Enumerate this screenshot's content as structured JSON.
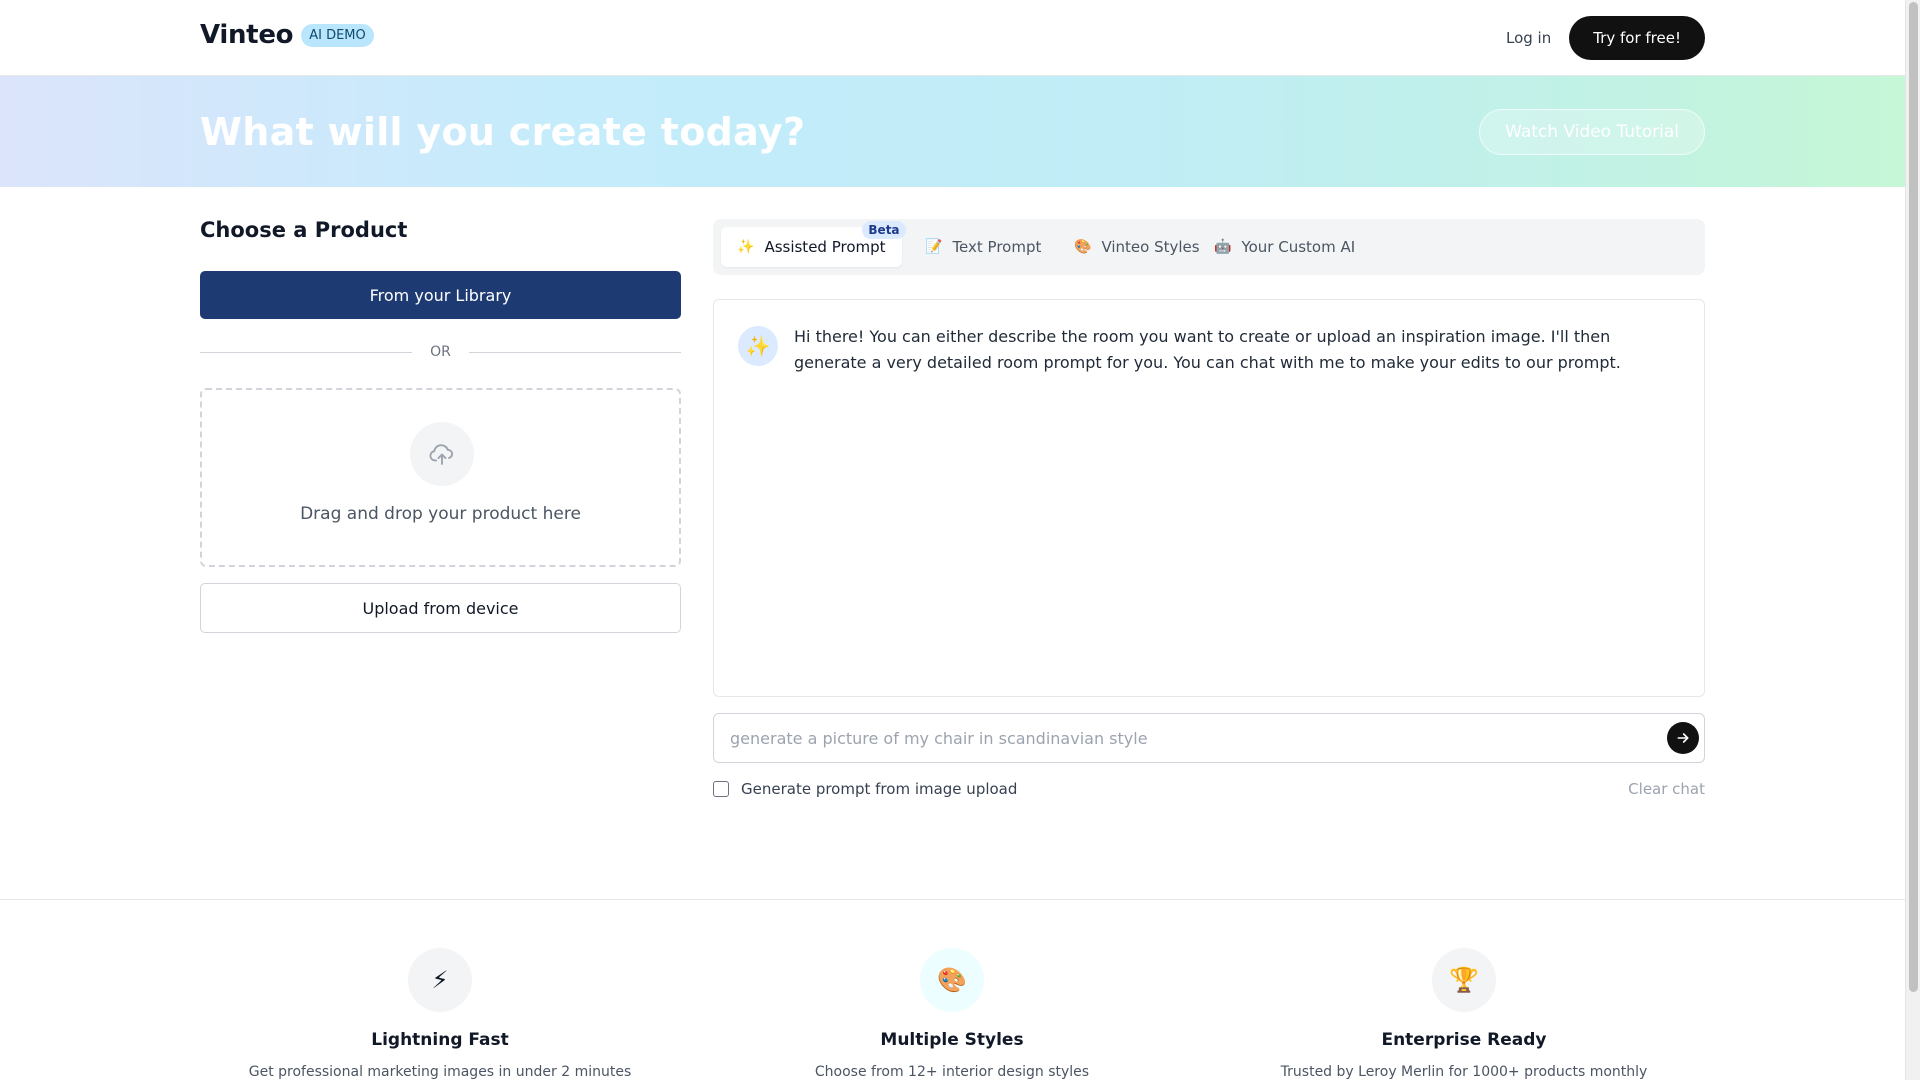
{
  "header": {
    "brand": "Vinteo",
    "badge": "AI DEMO",
    "login": "Log in",
    "cta": "Try for free!"
  },
  "hero": {
    "title": "What will you create today?",
    "tutorial": "Watch Video Tutorial"
  },
  "product": {
    "title": "Choose a Product",
    "library": "From your Library",
    "or": "OR",
    "drop_text": "Drag and drop your product here",
    "upload_device": "Upload from device"
  },
  "tabs": [
    {
      "emoji": "✨",
      "label": "Assisted Prompt",
      "badge": "Beta",
      "active": true
    },
    {
      "emoji": "📝",
      "label": "Text Prompt"
    },
    {
      "emoji": "🎨",
      "label": "Vinteo Styles"
    },
    {
      "emoji": "🤖",
      "label": "Your Custom AI"
    }
  ],
  "chat": {
    "avatar": "✨",
    "message": "Hi there! You can either describe the room you want to create or upload an inspiration image. I'll then generate a very detailed room prompt for you. You can chat with me to make your edits to our prompt.",
    "placeholder": "generate a picture of my chair in scandinavian style",
    "checkbox_label": "Generate prompt from image upload",
    "clear": "Clear chat"
  },
  "features": [
    {
      "icon": "⚡",
      "icon_bg": "#f3f4f6",
      "title": "Lightning Fast",
      "desc": "Get professional marketing images in under 2 minutes"
    },
    {
      "icon": "🎨",
      "icon_bg": "#ecfeff",
      "title": "Multiple Styles",
      "desc": "Choose from 12+ interior design styles"
    },
    {
      "icon": "🏆",
      "icon_bg": "#f3f4f6",
      "title": "Enterprise Ready",
      "desc": "Trusted by Leroy Merlin for 1000+ products monthly"
    }
  ],
  "colors": {
    "primary_button": "#1e3a73",
    "cta_button": "#111111",
    "badge_bg": "#bae6fd"
  }
}
